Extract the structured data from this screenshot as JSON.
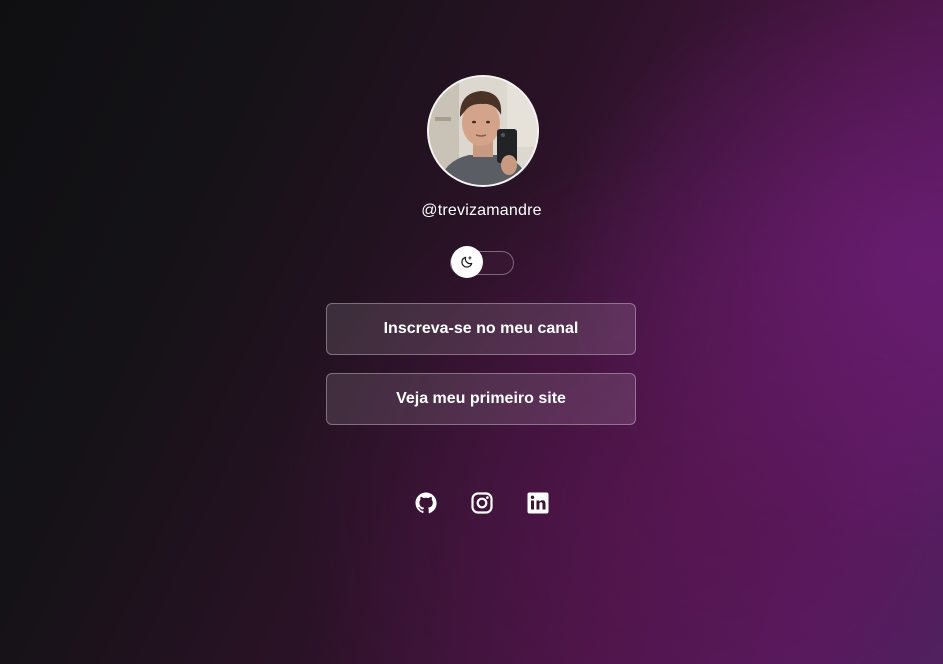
{
  "profile": {
    "username": "@trevizamandre",
    "avatar_alt": "profile photo"
  },
  "theme_toggle": {
    "icon": "moon-icon"
  },
  "links": [
    {
      "label": "Inscreva-se no meu canal"
    },
    {
      "label": "Veja meu primeiro site"
    }
  ],
  "social": [
    {
      "icon": "github-icon"
    },
    {
      "icon": "instagram-icon"
    },
    {
      "icon": "linkedin-icon"
    }
  ],
  "colors": {
    "background_dark": "#0f0f12",
    "background_accent": "#571a5e",
    "text": "#ffffff"
  }
}
